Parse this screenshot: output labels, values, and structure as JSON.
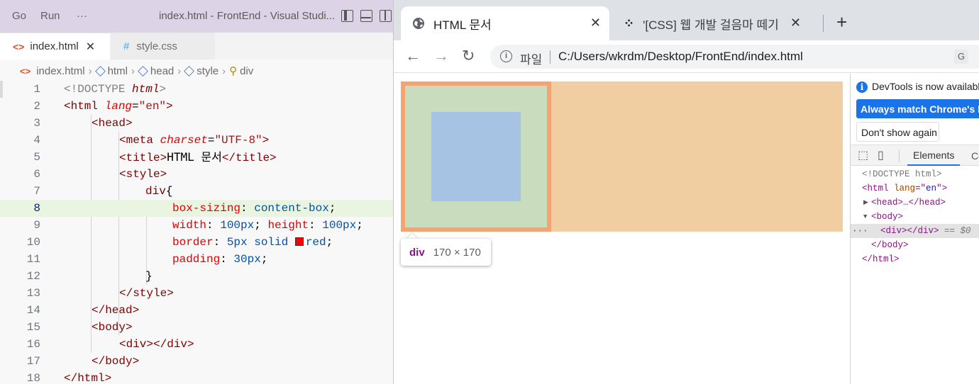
{
  "vscode": {
    "menu": [
      "Go",
      "Run",
      "···"
    ],
    "window_title": "index.html - FrontEnd - Visual Studi...",
    "tabs": [
      {
        "icon": "html-file-icon",
        "label": "index.html",
        "close": "✕"
      },
      {
        "icon": "css-file-icon",
        "label": "style.css"
      }
    ],
    "breadcrumb": [
      "index.html",
      "html",
      "head",
      "style",
      "div"
    ],
    "line_numbers": [
      "1",
      "2",
      "3",
      "4",
      "5",
      "6",
      "7",
      "8",
      "9",
      "10",
      "11",
      "12",
      "13",
      "14",
      "15",
      "16",
      "17",
      "18"
    ],
    "current_line": 8,
    "code": {
      "l1_a": "<!DOCTYPE ",
      "l1_b": "html",
      "l1_c": ">",
      "l2_a": "<html ",
      "l2_b": "lang",
      "l2_c": "=",
      "l2_d": "\"en\"",
      "l2_e": ">",
      "l3": "<head>",
      "l4_a": "<meta ",
      "l4_b": "charset",
      "l4_c": "=",
      "l4_d": "\"UTF-8\"",
      "l4_e": ">",
      "l5_a": "<title>",
      "l5_b": "HTML 문서",
      "l5_c": "</title>",
      "l6": "<style>",
      "l7_a": "div",
      "l7_b": "{",
      "l8_a": "box-sizing",
      "l8_b": ": ",
      "l8_c": "content-box",
      "l8_d": ";",
      "l9_a": "width",
      "l9_b": ": ",
      "l9_c": "100px",
      "l9_d": "; ",
      "l9_e": "height",
      "l9_f": ": ",
      "l9_g": "100px",
      "l9_h": ";",
      "l10_a": "border",
      "l10_b": ": ",
      "l10_c": "5px solid ",
      "l10_d": "red",
      "l10_e": ";",
      "l11_a": "padding",
      "l11_b": ": ",
      "l11_c": "30px",
      "l11_d": ";",
      "l12": "}",
      "l13": "</style>",
      "l14": "</head>",
      "l15": "<body>",
      "l16_a": "<div>",
      "l16_b": "</div>",
      "l17": "</body>",
      "l18": "</html>"
    }
  },
  "chrome": {
    "tabs": [
      {
        "icon": "globe-icon",
        "title": "HTML 문서",
        "close": "✕"
      },
      {
        "icon": "tistory-icon",
        "title": "'[CSS] 웹 개발 걸음마 떼기",
        "close": "✕"
      }
    ],
    "new_tab": "+",
    "address": {
      "scheme_label": "파일",
      "url": "C:/Users/wkrdm/Desktop/FrontEnd/index.html"
    },
    "tooltip": {
      "tag": "div",
      "size": "170 × 170"
    },
    "devtools": {
      "info": "DevTools is now available",
      "match_button": "Always match Chrome's lang",
      "dont_show": "Don't show again",
      "tabs": [
        "Elements",
        "Co"
      ],
      "tree": {
        "doctype": "<!DOCTYPE html>",
        "html_open": "<html ",
        "html_attr": "lang",
        "html_eq": "=\"",
        "html_val": "en",
        "html_close": "\">",
        "head": "<head>…</head>",
        "body_open": "<body>",
        "div": "<div></div>",
        "div_note": "== $0",
        "body_close": "</body>",
        "html_end": "</html>"
      }
    },
    "colors": {
      "margin": "#f0cea2",
      "border": "#f3a470",
      "padding": "#c9dcbe",
      "content": "#a7c3e3"
    }
  }
}
